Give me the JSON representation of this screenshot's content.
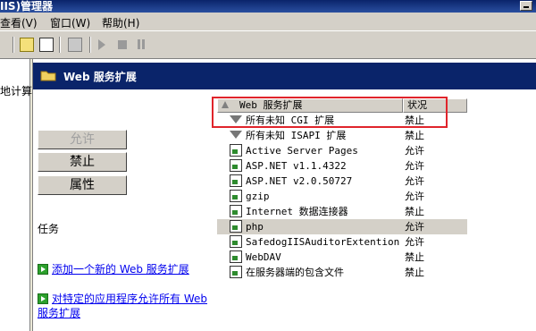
{
  "window": {
    "title": "IIS)管理器"
  },
  "menu": {
    "view": "查看(V)",
    "window": "窗口(W)",
    "help": "帮助(H)"
  },
  "tree": {
    "partial_label": "地计算"
  },
  "header": {
    "title": "Web 服务扩展"
  },
  "buttons": {
    "allow": "允许",
    "prohibit": "禁止",
    "properties": "属性"
  },
  "tasks": {
    "label": "任务",
    "add_new": "添加一个新的 Web 服务扩展",
    "allow_all": "对特定的应用程序允许所有 Web 服务扩展"
  },
  "table": {
    "columns": [
      "Web 服务扩展",
      "状况"
    ],
    "rows": [
      {
        "name": "所有未知 CGI 扩展",
        "status": "禁止",
        "icon": "filter-icon"
      },
      {
        "name": "所有未知 ISAPI 扩展",
        "status": "禁止",
        "icon": "filter-icon"
      },
      {
        "name": "Active Server Pages",
        "status": "允许",
        "icon": "extension-icon"
      },
      {
        "name": "ASP.NET v1.1.4322",
        "status": "允许",
        "icon": "extension-icon"
      },
      {
        "name": "ASP.NET v2.0.50727",
        "status": "允许",
        "icon": "extension-icon"
      },
      {
        "name": "gzip",
        "status": "允许",
        "icon": "extension-icon"
      },
      {
        "name": "Internet 数据连接器",
        "status": "禁止",
        "icon": "extension-icon"
      },
      {
        "name": "php",
        "status": "允许",
        "icon": "extension-icon"
      },
      {
        "name": "SafedogIISAuditorExtention",
        "status": "允许",
        "icon": "extension-icon"
      },
      {
        "name": "WebDAV",
        "status": "禁止",
        "icon": "extension-icon"
      },
      {
        "name": "在服务器端的包含文件",
        "status": "禁止",
        "icon": "extension-icon"
      }
    ]
  }
}
